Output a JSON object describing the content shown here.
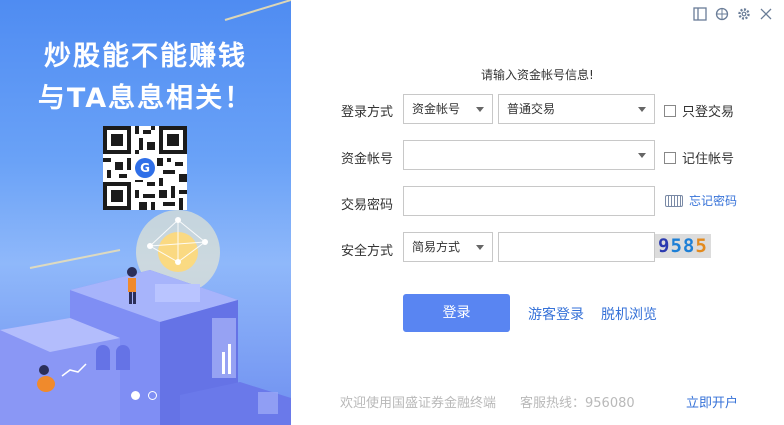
{
  "banner": {
    "headline_line1": "炒股能不能赚钱",
    "headline_line2": "与TA息息相关！",
    "qr_logo": "G",
    "carousel_pages": 2,
    "carousel_active": 1
  },
  "window_controls": {
    "icons": [
      "panel-icon",
      "theme-icon",
      "settings-icon",
      "close-icon"
    ]
  },
  "form": {
    "tip": "请输入资金帐号信息!",
    "login_method": {
      "label": "登录方式",
      "account_type": "资金帐号",
      "trade_type": "普通交易"
    },
    "only_trade": "只登交易",
    "account": {
      "label": "资金帐号",
      "value": ""
    },
    "remember_account": "记住帐号",
    "password": {
      "label": "交易密码",
      "value": ""
    },
    "forgot_password": "忘记密码",
    "security": {
      "label": "安全方式",
      "mode": "简易方式",
      "code_value": ""
    },
    "captcha": [
      "9",
      "5",
      "8",
      "5"
    ],
    "captcha_colors": [
      "#2b3bb0",
      "#1d7fd6",
      "#1d7fd6",
      "#e38a1d"
    ]
  },
  "actions": {
    "login": "登录",
    "guest_login": "游客登录",
    "offline_browse": "脱机浏览"
  },
  "footer": {
    "welcome": "欢迎使用国盛证券金融终端",
    "hotline": "客服热线：956080",
    "open_account": "立即开户"
  },
  "colors": {
    "accent": "#5985f2",
    "link": "#3672d8",
    "banner_top": "#4f8cf2"
  }
}
